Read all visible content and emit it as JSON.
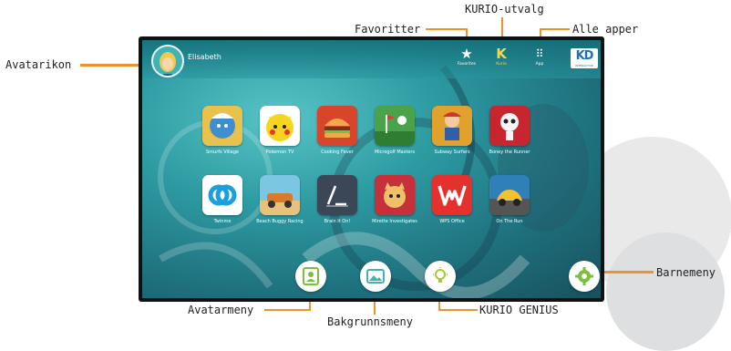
{
  "colors": {
    "accent": "#f0922b",
    "screen_teal": "#2d9aa2",
    "kurio_yellow": "#f5d84a"
  },
  "callouts": {
    "avatarikon": "Avatarikon",
    "favoritter": "Favoritter",
    "kurio_utvalg": "KURIO-utvalg",
    "alle_apper": "Alle apper",
    "barnemeny": "Barnemeny",
    "avatarmeny": "Avatarmeny",
    "bakgrunnsmeny": "Bakgrunnsmeny",
    "kurio_genius": "KURIO GENIUS"
  },
  "topbar": {
    "username": "Elisabeth",
    "favorites_label": "Favorites",
    "kurio_label": "Kurio",
    "apps_label": "App",
    "logo_text": "KD",
    "logo_sub": "INTERACTIVE"
  },
  "apps": [
    {
      "name": "Smurfs Village",
      "icon": "smurf-icon",
      "color": "#3f8fd0"
    },
    {
      "name": "Pokemon TV",
      "icon": "pikachu-icon",
      "color": "#1d4f9a"
    },
    {
      "name": "Cooking Fever",
      "icon": "burger-icon",
      "color": "#d8452b"
    },
    {
      "name": "Microgolf Masters",
      "icon": "golf-icon",
      "color": "#4aa34a"
    },
    {
      "name": "Subway Surfers",
      "icon": "surfer-icon",
      "color": "#e0a22c"
    },
    {
      "name": "Boney the Runner",
      "icon": "skeleton-icon",
      "color": "#c7262f"
    },
    {
      "name": "Twinme",
      "icon": "twinme-icon",
      "color": "#ffffff"
    },
    {
      "name": "Beach Buggy Racing",
      "icon": "buggy-icon",
      "color": "#d77a2a"
    },
    {
      "name": "Brain It On!",
      "icon": "brain-icon",
      "color": "#3b4757"
    },
    {
      "name": "Mirette Investigates",
      "icon": "cat-icon",
      "color": "#c5303a"
    },
    {
      "name": "WPS Office",
      "icon": "wps-icon",
      "color": "#e5312d"
    },
    {
      "name": "On The Run",
      "icon": "car-icon",
      "color": "#2f7fb8"
    }
  ]
}
